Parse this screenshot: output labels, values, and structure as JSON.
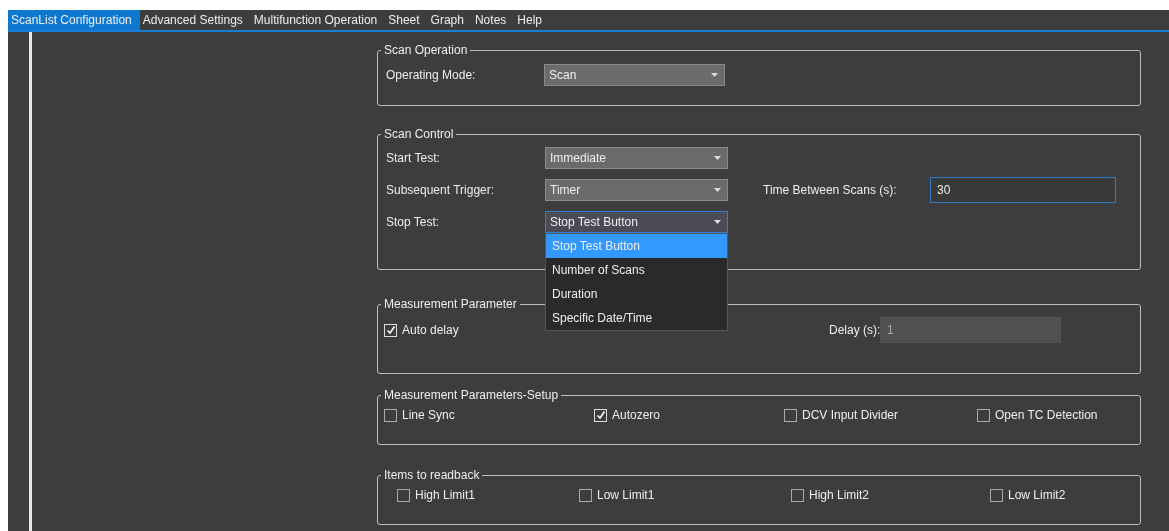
{
  "menu": [
    {
      "label": "ScanList Configuration",
      "selected": true
    },
    {
      "label": "Advanced Settings",
      "selected": false
    },
    {
      "label": "Multifunction Operation",
      "selected": false
    },
    {
      "label": "Sheet",
      "selected": false
    },
    {
      "label": "Graph",
      "selected": false
    },
    {
      "label": "Notes",
      "selected": false
    },
    {
      "label": "Help",
      "selected": false
    }
  ],
  "scan_operation": {
    "title": "Scan Operation",
    "operating_mode": {
      "label": "Operating Mode:",
      "value": "Scan"
    }
  },
  "scan_control": {
    "title": "Scan Control",
    "start_test": {
      "label": "Start Test:",
      "value": "Immediate"
    },
    "subsequent_trigger": {
      "label": "Subsequent Trigger:",
      "value": "Timer"
    },
    "time_between_scans": {
      "label": "Time Between Scans (s):",
      "value": "30"
    },
    "stop_test": {
      "label": "Stop Test:",
      "value": "Stop Test Button",
      "expanded": true,
      "options": [
        {
          "label": "Stop Test Button",
          "selected": true
        },
        {
          "label": "Number of Scans",
          "selected": false
        },
        {
          "label": "Duration",
          "selected": false
        },
        {
          "label": "Specific Date/Time",
          "selected": false
        }
      ]
    }
  },
  "measurement_parameters": {
    "title": "Measurement Parameter",
    "auto_delay": {
      "label": "Auto delay",
      "checked": true
    },
    "delay": {
      "label": "Delay (s):",
      "value": "1",
      "disabled": true
    }
  },
  "setup": {
    "title": "Measurement Parameters-Setup",
    "checkboxes": [
      {
        "label": "Line Sync",
        "checked": false
      },
      {
        "label": "Autozero",
        "checked": true
      },
      {
        "label": "DCV Input Divider",
        "checked": false
      },
      {
        "label": "Open TC Detection",
        "checked": false
      }
    ]
  },
  "readback": {
    "title": "Items to readback",
    "checkboxes": [
      {
        "label": "High Limit1",
        "checked": false
      },
      {
        "label": "Low Limit1",
        "checked": false
      },
      {
        "label": "High Limit2",
        "checked": false
      },
      {
        "label": "Low Limit2",
        "checked": false
      }
    ]
  }
}
